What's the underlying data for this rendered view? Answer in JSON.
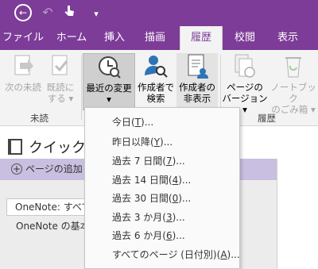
{
  "qat": {
    "undo_glyph": "↶",
    "more_glyph": "▾"
  },
  "tabs": [
    {
      "label": "ファイル"
    },
    {
      "label": "ホーム"
    },
    {
      "label": "挿入"
    },
    {
      "label": "描画"
    },
    {
      "label": "履歴",
      "active": true
    },
    {
      "label": "校閲"
    },
    {
      "label": "表示"
    }
  ],
  "ribbon": {
    "next_unread": "次の未読",
    "mark_read": [
      "既読に",
      "する"
    ],
    "recent_changes": "最近の変更",
    "search_by_author": [
      "作成者で",
      "検索"
    ],
    "hide_authors": [
      "作成者の",
      "非表示"
    ],
    "page_versions": [
      "ページの",
      "バージョン"
    ],
    "notebook_recycle_bin": [
      "ノートブック",
      "のごみ箱"
    ],
    "group_unread": "未読",
    "group_history": "履歴",
    "dropdown_arrow": "▾"
  },
  "section": {
    "title": "クイック ノ"
  },
  "pages": {
    "add_page": "ページの追加",
    "search_value": "OneNote: すべて",
    "items": [
      "OneNote の基本"
    ]
  },
  "dropdown": {
    "items": [
      {
        "label": "今日(",
        "key": "T",
        "suffix": ")..."
      },
      {
        "label": "昨日以降(",
        "key": "Y",
        "suffix": ")..."
      },
      {
        "label": "過去 7 日間(",
        "key": "7",
        "suffix": ")..."
      },
      {
        "label": "過去 14 日間(",
        "key": "4",
        "suffix": ")..."
      },
      {
        "label": "過去 30 日間(",
        "key": "0",
        "suffix": ")..."
      },
      {
        "label": "過去 3 か月(",
        "key": "3",
        "suffix": ")..."
      },
      {
        "label": "過去 6 か月(",
        "key": "6",
        "suffix": ")..."
      },
      {
        "label": "すべてのページ (日付別)(",
        "key": "A",
        "suffix": ")..."
      }
    ]
  },
  "colors": {
    "accent": "#7d3c98",
    "pages_header": "#c9bfe0"
  }
}
